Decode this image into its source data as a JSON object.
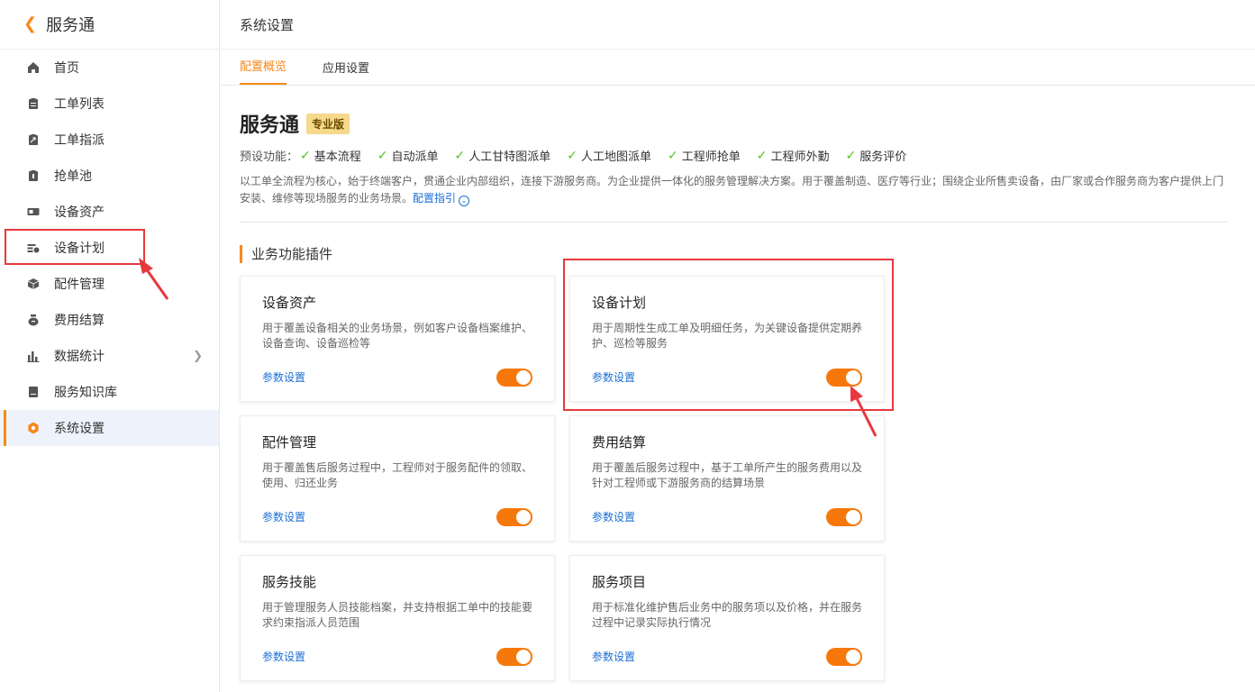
{
  "sidebar": {
    "back_icon": "chevron-left-icon",
    "title": "服务通",
    "items": [
      {
        "label": "首页",
        "icon": "home-icon"
      },
      {
        "label": "工单列表",
        "icon": "clipboard-icon"
      },
      {
        "label": "工单指派",
        "icon": "clipboard-arrow-icon"
      },
      {
        "label": "抢单池",
        "icon": "clipboard-grab-icon"
      },
      {
        "label": "设备资产",
        "icon": "device-card-icon"
      },
      {
        "label": "设备计划",
        "icon": "plan-icon"
      },
      {
        "label": "配件管理",
        "icon": "box-icon"
      },
      {
        "label": "费用结算",
        "icon": "moneybag-icon"
      },
      {
        "label": "数据统计",
        "icon": "bar-chart-icon"
      },
      {
        "label": "服务知识库",
        "icon": "book-icon"
      },
      {
        "label": "系统设置",
        "icon": "gear-icon"
      }
    ]
  },
  "header": {
    "title": "系统设置"
  },
  "tabs": [
    {
      "label": "配置概览"
    },
    {
      "label": "应用设置"
    }
  ],
  "product": {
    "name": "服务通",
    "edition": "专业版",
    "features_label": "预设功能：",
    "features": [
      "基本流程",
      "自动派单",
      "人工甘特图派单",
      "人工地图派单",
      "工程师抢单",
      "工程师外勤",
      "服务评价"
    ],
    "description": "以工单全流程为核心，始于终端客户，贯通企业内部组织，连接下游服务商。为企业提供一体化的服务管理解决方案。用于覆盖制造、医疗等行业；围绕企业所售卖设备，由厂家或合作服务商为客户提供上门安装、维修等现场服务的业务场景。",
    "guide_link": "配置指引"
  },
  "section": {
    "title": "业务功能插件"
  },
  "plugins": [
    {
      "title": "设备资产",
      "desc": "用于覆盖设备相关的业务场景，例如客户设备档案维护、设备查询、设备巡检等",
      "link": "参数设置",
      "enabled": true
    },
    {
      "title": "设备计划",
      "desc": "用于周期性生成工单及明细任务，为关键设备提供定期养护、巡检等服务",
      "link": "参数设置",
      "enabled": true
    },
    {
      "title": "配件管理",
      "desc": "用于覆盖售后服务过程中，工程师对于服务配件的领取、使用、归还业务",
      "link": "参数设置",
      "enabled": true
    },
    {
      "title": "费用结算",
      "desc": "用于覆盖后服务过程中，基于工单所产生的服务费用以及针对工程师或下游服务商的结算场景",
      "link": "参数设置",
      "enabled": true
    },
    {
      "title": "服务技能",
      "desc": "用于管理服务人员技能档案，并支持根据工单中的技能要求约束指派人员范围",
      "link": "参数设置",
      "enabled": true
    },
    {
      "title": "服务项目",
      "desc": "用于标准化维护售后业务中的服务项以及价格，并在服务过程中记录实际执行情况",
      "link": "参数设置",
      "enabled": true
    }
  ],
  "colors": {
    "accent": "#f7891c",
    "toggle_on": "#f7780a",
    "link": "#1a6fd6",
    "check": "#52c41a",
    "annotation": "#e8383d"
  }
}
